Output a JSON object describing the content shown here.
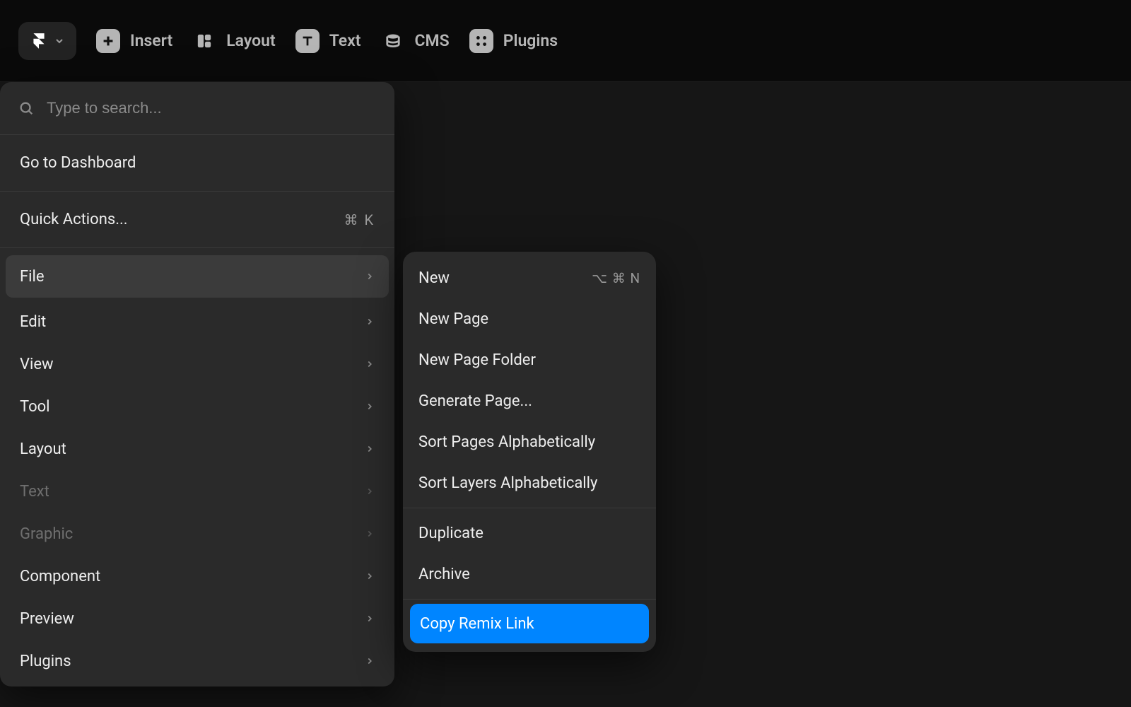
{
  "toolbar": {
    "items": [
      {
        "label": "Insert"
      },
      {
        "label": "Layout"
      },
      {
        "label": "Text"
      },
      {
        "label": "CMS"
      },
      {
        "label": "Plugins"
      }
    ]
  },
  "search": {
    "placeholder": "Type to search..."
  },
  "menu": {
    "dashboard": "Go to Dashboard",
    "quick_actions": {
      "label": "Quick Actions...",
      "shortcut": "⌘ K"
    },
    "items": [
      {
        "label": "File",
        "selected": true
      },
      {
        "label": "Edit"
      },
      {
        "label": "View"
      },
      {
        "label": "Tool"
      },
      {
        "label": "Layout"
      },
      {
        "label": "Text",
        "disabled": true
      },
      {
        "label": "Graphic",
        "disabled": true
      },
      {
        "label": "Component"
      },
      {
        "label": "Preview"
      },
      {
        "label": "Plugins"
      }
    ]
  },
  "submenu": {
    "group1": [
      {
        "label": "New",
        "shortcut": "⌥ ⌘ N"
      },
      {
        "label": "New Page"
      },
      {
        "label": "New Page Folder"
      },
      {
        "label": "Generate Page..."
      },
      {
        "label": "Sort Pages Alphabetically"
      },
      {
        "label": "Sort Layers Alphabetically"
      }
    ],
    "group2": [
      {
        "label": "Duplicate"
      },
      {
        "label": "Archive"
      }
    ],
    "group3": [
      {
        "label": "Copy Remix Link",
        "highlight": true
      }
    ]
  }
}
